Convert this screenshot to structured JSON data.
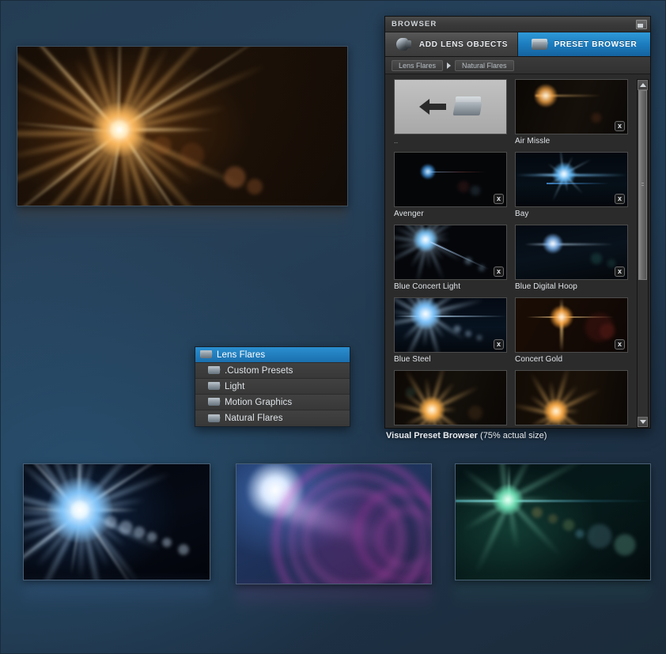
{
  "background": {
    "base_color": "#22394f",
    "accent_color": "#1d7fc4"
  },
  "hero": {
    "name": "golden-starburst-preview",
    "flare_color": "#ffb347",
    "core_color": "#fff6e0"
  },
  "folder_menu": {
    "name": "preset-folder-menu",
    "items": [
      {
        "label": "Lens Flares",
        "selected": true,
        "indent": false,
        "icon": "folder-icon"
      },
      {
        "label": ".Custom Presets",
        "selected": false,
        "indent": true,
        "icon": "folder-icon"
      },
      {
        "label": "Light",
        "selected": false,
        "indent": true,
        "icon": "folder-icon"
      },
      {
        "label": "Motion Graphics",
        "selected": false,
        "indent": true,
        "icon": "folder-icon"
      },
      {
        "label": "Natural Flares",
        "selected": false,
        "indent": true,
        "icon": "folder-icon"
      }
    ]
  },
  "browser": {
    "title": "BROWSER",
    "dock_icon": "window-dock-icon",
    "tabs": [
      {
        "label": "ADD LENS OBJECTS",
        "active": false,
        "icon": "lens-icon"
      },
      {
        "label": "PRESET BROWSER",
        "active": true,
        "icon": "folder-icon"
      }
    ],
    "breadcrumb": {
      "root": "Lens Flares",
      "separator": "chevron-right-icon",
      "current": "Natural Flares"
    },
    "scrollbar": {
      "up_icon": "arrow-up-icon",
      "down_icon": "arrow-down-icon",
      "thumb_position_percent": 0,
      "thumb_size_percent": 58
    },
    "presets": [
      {
        "label": "..",
        "type": "parent-folder",
        "removable": false,
        "flare": "none"
      },
      {
        "label": "Air Missle",
        "type": "preset",
        "removable": true,
        "flare": "amber-streak",
        "badge": "x"
      },
      {
        "label": "Avenger",
        "type": "preset",
        "removable": true,
        "flare": "cyan-small",
        "badge": "x"
      },
      {
        "label": "Bay",
        "type": "preset",
        "removable": true,
        "flare": "blue-anamorphic",
        "badge": "x"
      },
      {
        "label": "Blue Concert Light",
        "type": "preset",
        "removable": true,
        "flare": "blue-star-ghosts",
        "badge": "x"
      },
      {
        "label": "Blue Digital Hoop",
        "type": "preset",
        "removable": true,
        "flare": "blue-wide-streak",
        "badge": "x"
      },
      {
        "label": "Blue Steel",
        "type": "preset",
        "removable": true,
        "flare": "blue-bright-star",
        "badge": "x"
      },
      {
        "label": "Concert Gold",
        "type": "preset",
        "removable": true,
        "flare": "gold-column",
        "badge": "x"
      },
      {
        "label": "",
        "type": "preset",
        "removable": false,
        "flare": "gold-star-partial"
      },
      {
        "label": "",
        "type": "preset",
        "removable": false,
        "flare": "gold-star-partial2"
      }
    ]
  },
  "caption": {
    "bold_text": "Visual Preset Browser",
    "note_text": " (75% actual size)"
  },
  "bottom_shots": [
    {
      "name": "blue-starburst-shot",
      "flare_color": "#9fd0ff"
    },
    {
      "name": "magenta-ring-shot",
      "flare_color": "#e040c0"
    },
    {
      "name": "green-flare-shot",
      "flare_color": "#5fd9a0"
    }
  ]
}
